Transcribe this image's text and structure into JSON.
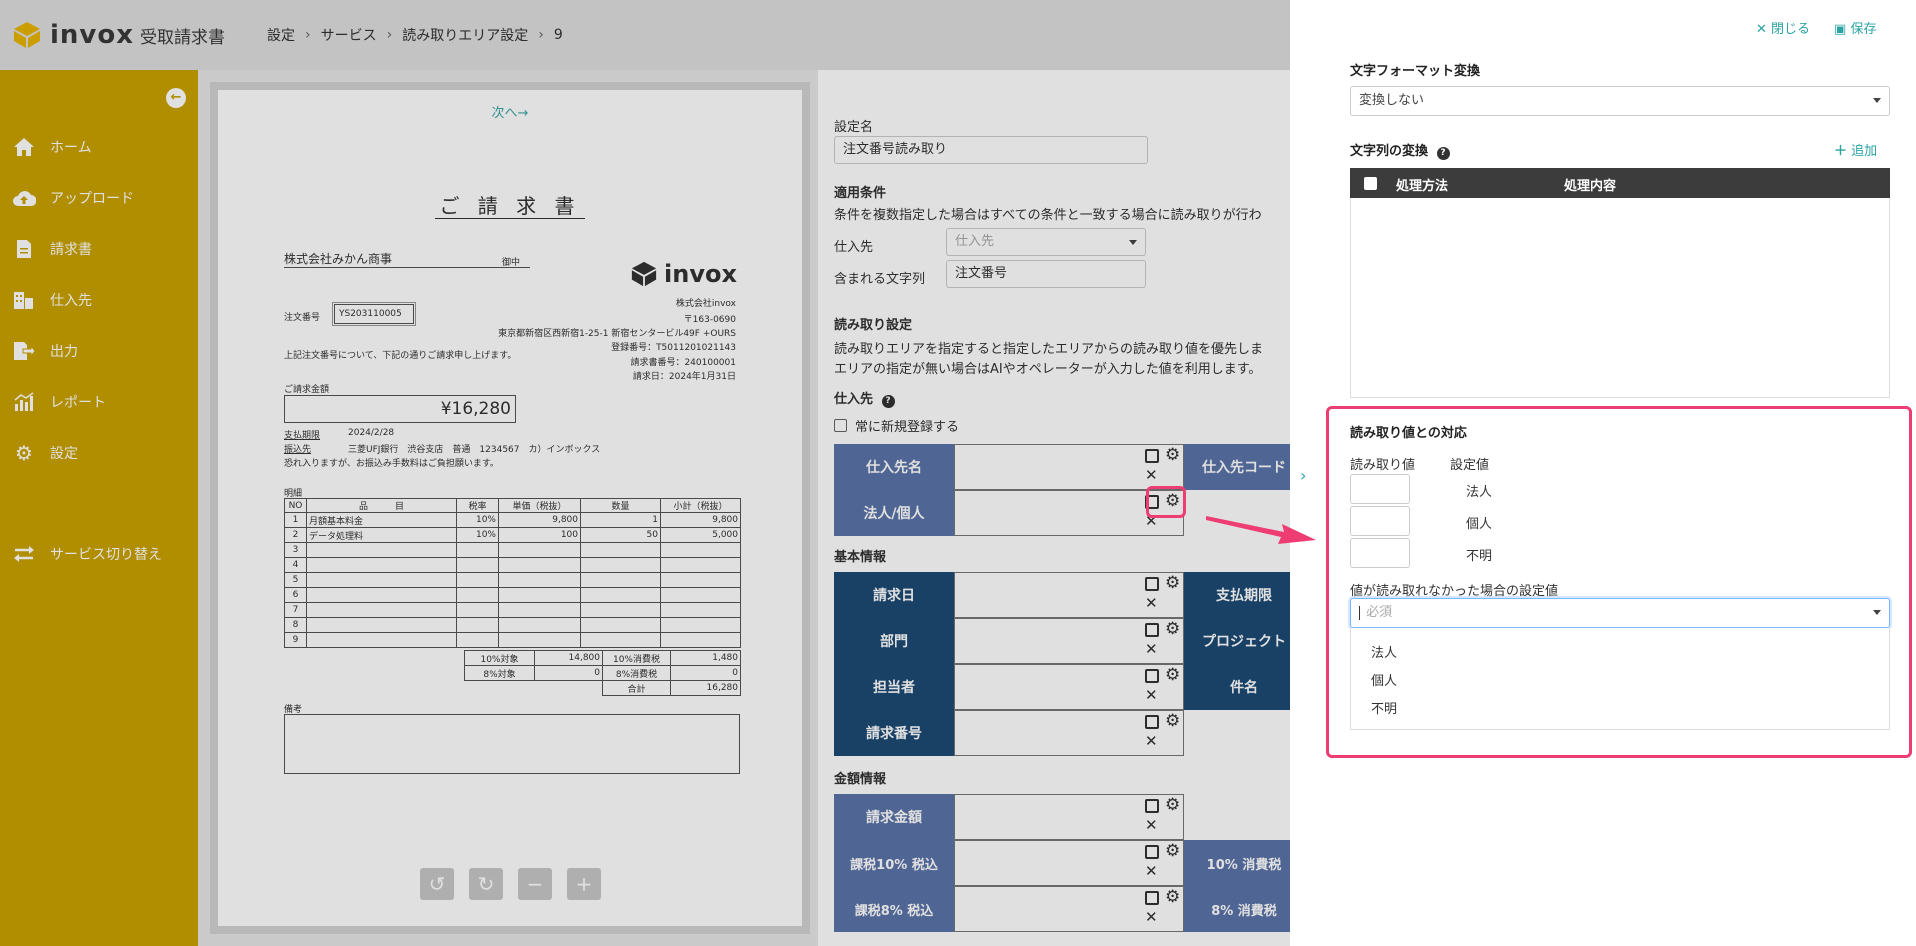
{
  "header": {
    "brand": "invox",
    "product": "受取請求書",
    "breadcrumb": [
      "設定",
      "サービス",
      "読み取りエリア設定",
      "9"
    ]
  },
  "sidebar": {
    "collapse_icon": "arrow-left-circle-icon",
    "items": [
      {
        "label": "ホーム",
        "icon": "home-icon"
      },
      {
        "label": "アップロード",
        "icon": "cloud-upload-icon"
      },
      {
        "label": "請求書",
        "icon": "document-icon"
      },
      {
        "label": "仕入先",
        "icon": "building-icon"
      },
      {
        "label": "出力",
        "icon": "export-icon"
      },
      {
        "label": "レポート",
        "icon": "report-chart-icon"
      },
      {
        "label": "設定",
        "icon": "gear-icon"
      },
      {
        "label": "サービス切り替え",
        "icon": "switch-icon"
      }
    ]
  },
  "viewer": {
    "next_label": "次へ→",
    "invoice": {
      "title": "ご 請 求 書",
      "customer": "株式会社みかん商事",
      "honorific": "御中",
      "issuer_logo": "invox",
      "issuer_name": "株式会社invox",
      "issuer_postal": "〒163-0690",
      "issuer_address": "東京都新宿区西新宿1-25-1 新宿センタービル49F +OURS",
      "registration": "登録番号：T5011201021143",
      "invoice_number": "請求書番号：240100001",
      "invoice_date": "請求日：2024年1月31日",
      "order_label": "注文番号",
      "order_value": "YS203110005",
      "intro": "上記注文番号について、下記の通りご請求申し上げます。",
      "amount_label": "ご請求金額",
      "amount": "¥16,280",
      "due_label": "支払期限",
      "due_date": "2024/2/28",
      "bank_label": "振込先",
      "bank": "三菱UFJ銀行　渋谷支店　普通　1234567　カ）インボックス",
      "note": "恐れ入りますが、お振込み手数料はご負担願います。",
      "details_label": "明細",
      "columns": [
        "NO",
        "品　　　目",
        "税率",
        "単価（税抜）",
        "数量",
        "小計（税抜）"
      ],
      "rows": [
        [
          "1",
          "月額基本料金",
          "10%",
          "9,800",
          "1",
          "9,800"
        ],
        [
          "2",
          "データ処理料",
          "10%",
          "100",
          "50",
          "5,000"
        ],
        [
          "3",
          "",
          "",
          "",
          "",
          ""
        ],
        [
          "4",
          "",
          "",
          "",
          "",
          ""
        ],
        [
          "5",
          "",
          "",
          "",
          "",
          ""
        ],
        [
          "6",
          "",
          "",
          "",
          "",
          ""
        ],
        [
          "7",
          "",
          "",
          "",
          "",
          ""
        ],
        [
          "8",
          "",
          "",
          "",
          "",
          ""
        ],
        [
          "9",
          "",
          "",
          "",
          "",
          ""
        ]
      ],
      "summary": [
        [
          "10%対象",
          "14,800",
          "10%消費税",
          "1,480"
        ],
        [
          "8%対象",
          "0",
          "8%消費税",
          "0"
        ],
        [
          "",
          "",
          "合計",
          "16,280"
        ]
      ],
      "remarks_label": "備考"
    },
    "tools": [
      "undo-icon",
      "redo-icon",
      "zoom-out-icon",
      "zoom-in-icon"
    ]
  },
  "settings": {
    "name_label": "設定名",
    "name_value": "注文番号読み取り",
    "cond_label": "適用条件",
    "cond_desc": "条件を複数指定した場合はすべての条件と一致する場合に読み取りが行わ",
    "supplier_label": "仕入先",
    "supplier_placeholder": "仕入先",
    "contains_label": "含まれる文字列",
    "contains_value": "注文番号",
    "read_label": "読み取り設定",
    "read_desc1": "読み取りエリアを指定すると指定したエリアからの読み取り値を優先しま",
    "read_desc2": "エリアの指定が無い場合はAIやオペレーターが入力した値を利用します。",
    "supplier_section": "仕入先",
    "always_register": "常に新規登録する",
    "supplier_name": "仕入先名",
    "supplier_code": "仕入先コード",
    "corp_personal": "法人/個人",
    "basic_label": "基本情報",
    "invoice_date": "請求日",
    "due_date": "支払期限",
    "department": "部門",
    "project": "プロジェクト",
    "person": "担当者",
    "subject": "件名",
    "invoice_number": "請求番号",
    "amount_label": "金額情報",
    "invoice_amount": "請求金額",
    "tax10": "課税10% 税込",
    "tax10_cons": "10% 消費税",
    "tax8": "課税8% 税込",
    "tax8_cons": "8% 消費税"
  },
  "panel": {
    "close_label": "閉じる",
    "save_label": "保存",
    "format_label": "文字フォーマット変換",
    "format_value": "変換しない",
    "convert_label": "文字列の変換",
    "add_label": "追加",
    "table_method": "処理方法",
    "table_content": "処理内容",
    "mapping_label": "読み取り値との対応",
    "read_value_col": "読み取り値",
    "setting_value_col": "設定値",
    "mapping_options": [
      "法人",
      "個人",
      "不明"
    ],
    "fallback_label": "値が読み取れなかった場合の設定値",
    "fallback_placeholder": "必須",
    "dropdown_options": [
      "法人",
      "個人",
      "不明"
    ]
  },
  "colors": {
    "sidebar": "#c9a200",
    "grid_dark": "#1d4a75",
    "grid_light": "#5b73a8",
    "accent": "#2aa3a3",
    "highlight": "#ee3d73"
  }
}
